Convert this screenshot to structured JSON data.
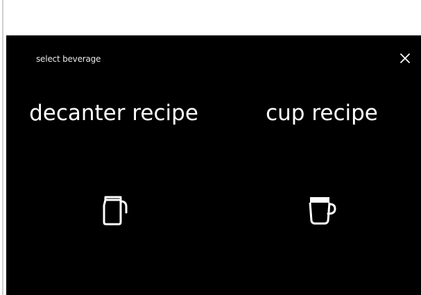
{
  "screen": {
    "title": "select beverage",
    "close_icon": "close-icon"
  },
  "options": [
    {
      "label": "decanter recipe",
      "icon": "decanter-icon"
    },
    {
      "label": "cup recipe",
      "icon": "cup-icon"
    }
  ],
  "colors": {
    "screen_background": "#000000",
    "text": "#ffffff"
  }
}
